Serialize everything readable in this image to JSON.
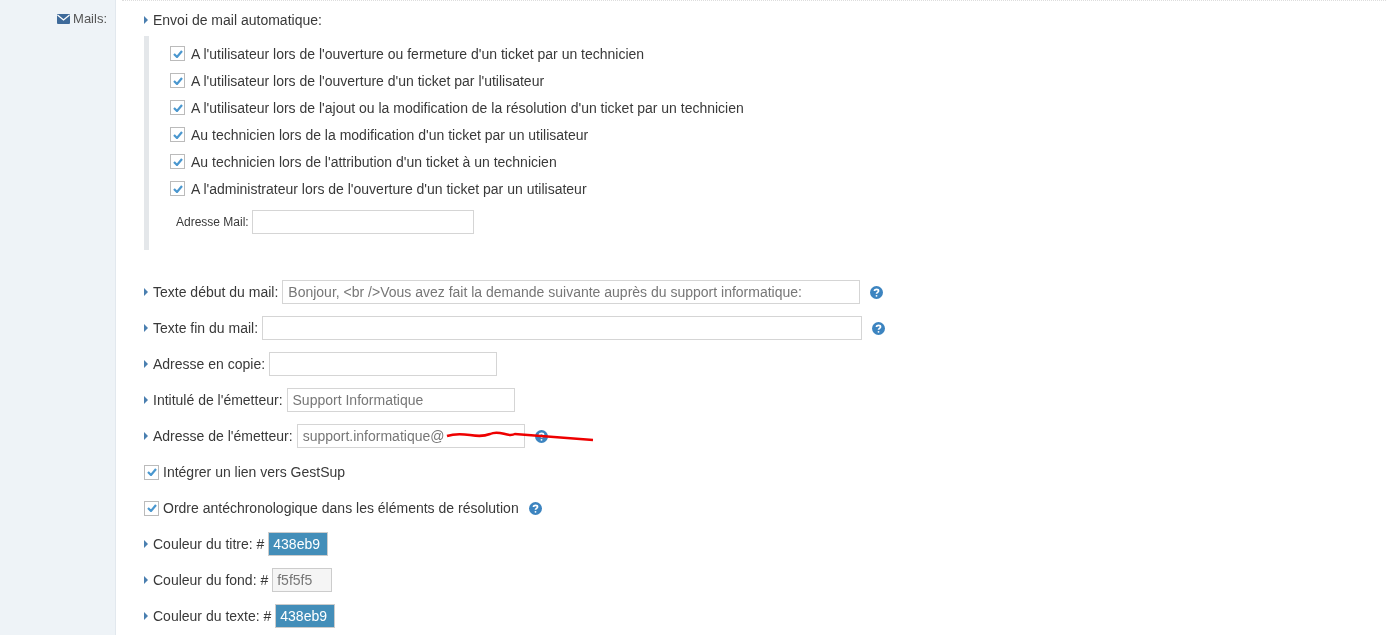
{
  "section": {
    "label": "Mails:"
  },
  "auto_mail": {
    "label": "Envoi de mail automatique:",
    "options": [
      {
        "label": "A l'utilisateur lors de l'ouverture ou fermeture d'un ticket par un technicien",
        "checked": true
      },
      {
        "label": "A l'utilisateur lors de l'ouverture d'un ticket par l'utilisateur",
        "checked": true
      },
      {
        "label": "A l'utilisateur lors de l'ajout ou la modification de la résolution d'un ticket par un technicien",
        "checked": true
      },
      {
        "label": "Au technicien lors de la modification d'un ticket par un utilisateur",
        "checked": true
      },
      {
        "label": "Au technicien lors de l'attribution d'un ticket à un technicien",
        "checked": true
      },
      {
        "label": "A l'administrateur lors de l'ouverture d'un ticket par un utilisateur",
        "checked": true
      }
    ],
    "address": {
      "label": "Adresse Mail:"
    }
  },
  "settings": [
    {
      "kind": "text",
      "label": "Texte début du mail:",
      "value": "Bonjour, <br />Vous avez fait la demande suivante auprès du support informatique:",
      "help": true
    },
    {
      "kind": "text",
      "label": "Texte fin du mail:",
      "help": true
    },
    {
      "kind": "text",
      "label": "Adresse en copie:",
      "help": false
    },
    {
      "kind": "text",
      "label": "Intitulé de l'émetteur:",
      "value": "Support Informatique",
      "help": false
    },
    {
      "kind": "text",
      "label": "Adresse de l'émetteur:",
      "value": "support.informatique@",
      "help": true,
      "redacted": true
    },
    {
      "kind": "checkbox",
      "label": "Intégrer un lien vers GestSup",
      "checked": true,
      "help": false
    },
    {
      "kind": "checkbox",
      "label": "Ordre antéchronologique dans les éléments de résolution",
      "checked": true,
      "help": true
    },
    {
      "kind": "color",
      "label": "Couleur du titre: #",
      "value": "438eb9",
      "color": "#438eb9"
    },
    {
      "kind": "color",
      "label": "Couleur du fond: #",
      "value": "f5f5f5",
      "color": "#f5f5f5"
    },
    {
      "kind": "color",
      "label": "Couleur du texte: #",
      "value": "438eb9",
      "color": "#438eb9"
    }
  ]
}
